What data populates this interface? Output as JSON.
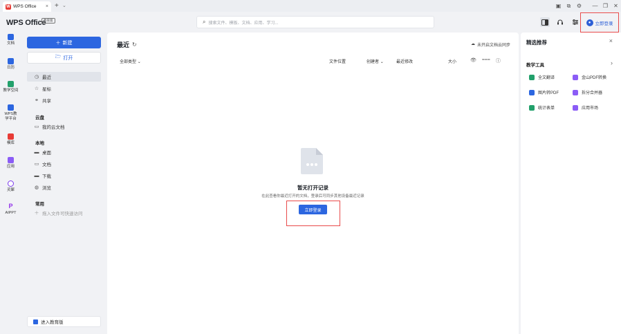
{
  "titlebar": {
    "tab_title": "WPS Office",
    "tab_logo": "W",
    "tab_close": "×",
    "new_tab": "+",
    "dropdown": "⌄",
    "controls": [
      "▣",
      "⧉",
      "⚙",
      "—",
      "❐",
      "✕"
    ]
  },
  "header": {
    "brand": "WPS Office",
    "brand_badge": "教育版",
    "search_placeholder": "搜索文件、模板、文档、应用、学习...",
    "login_label": "立即登录",
    "avatar_glyph": "●",
    "icons": [
      "sidebar-panel-icon",
      "headset-icon",
      "sliders-icon"
    ]
  },
  "rail": [
    {
      "label": "文档",
      "color": "#2c66e0"
    },
    {
      "label": "日历",
      "color": "#2c66e0"
    },
    {
      "label": "教学空间",
      "color": "#22a06b"
    },
    {
      "label": "WPS教学平台",
      "color": "#2c66e0"
    },
    {
      "label": "模库",
      "color": "#e73b36"
    },
    {
      "label": "应用",
      "color": "#8b5cf6"
    },
    {
      "label": "灵犀",
      "color": "#7c3aed"
    },
    {
      "label": "AIPPT",
      "color": "#9333ea"
    }
  ],
  "sidebar": {
    "new_label": "新建",
    "open_label": "打开",
    "nav_top": [
      {
        "label": "最近",
        "icon": "◷",
        "active": true
      },
      {
        "label": "星标",
        "icon": "☆",
        "active": false
      },
      {
        "label": "共享",
        "icon": "⚭",
        "active": false
      }
    ],
    "cloud_section": "云盘",
    "cloud_items": [
      {
        "label": "我的云文档",
        "icon": "▭"
      }
    ],
    "local_section": "本地",
    "local_items": [
      {
        "label": "桌面",
        "icon": "▬"
      },
      {
        "label": "文档",
        "icon": "▭"
      },
      {
        "label": "下载",
        "icon": "▬"
      },
      {
        "label": "浏览",
        "icon": "◍"
      }
    ],
    "common_section": "常用",
    "common_add": "拖入文件可快速访问",
    "edu_label": "进入教育版"
  },
  "main": {
    "title": "最近",
    "refresh_glyph": "↻",
    "sync_label": "未开启文档云同步",
    "columns": {
      "type": "全部类型",
      "location": "文件位置",
      "creator": "创建者",
      "modified": "最近修改",
      "size": "大小"
    },
    "empty_title": "暂无打开记录",
    "empty_sub": "在此查看你最近打开的文档，登录后可同步其他设备最近记录",
    "login_button": "立即登录"
  },
  "rpanel": {
    "title": "精选推荐",
    "close": "×",
    "section": "教学工具",
    "arrow": "›",
    "tools": [
      {
        "label": "全文翻译",
        "color": "#22a06b"
      },
      {
        "label": "金山PDF转换",
        "color": "#8b5cf6"
      },
      {
        "label": "图片转PDF",
        "color": "#2c66e0"
      },
      {
        "label": "拆分合并器",
        "color": "#8b5cf6"
      },
      {
        "label": "统计表单",
        "color": "#22a06b"
      },
      {
        "label": "应用市场",
        "color": "#8b5cf6"
      }
    ]
  }
}
